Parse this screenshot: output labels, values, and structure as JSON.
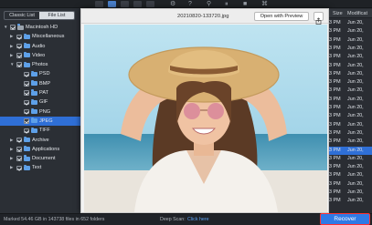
{
  "toolbar": {
    "icons": [
      "list-view-icon",
      "grid-view-icon",
      "column-view-icon",
      "filter-icon",
      "gear-icon",
      "sort-icon",
      "help-icon",
      "search-icon",
      "pause-icon",
      "stop-icon",
      "tag-icon"
    ]
  },
  "sidebar": {
    "tabs": [
      "Classic List",
      "File List"
    ],
    "active_tab": "File List",
    "items": [
      {
        "label": "Macintosh HD",
        "level": 0,
        "expanded": true,
        "checked": true,
        "icon": "drive-icon"
      },
      {
        "label": "Miscellaneous",
        "level": 1,
        "expanded": false,
        "checked": true,
        "icon": "folder-icon"
      },
      {
        "label": "Audio",
        "level": 1,
        "expanded": false,
        "checked": true,
        "icon": "folder-icon"
      },
      {
        "label": "Video",
        "level": 1,
        "expanded": false,
        "checked": true,
        "icon": "folder-icon"
      },
      {
        "label": "Photos",
        "level": 1,
        "expanded": true,
        "checked": true,
        "icon": "folder-icon"
      },
      {
        "label": "PSD",
        "level": 2,
        "checked": true,
        "icon": "folder-icon"
      },
      {
        "label": "BMP",
        "level": 2,
        "checked": true,
        "icon": "folder-icon"
      },
      {
        "label": "PAT",
        "level": 2,
        "checked": true,
        "icon": "folder-icon"
      },
      {
        "label": "GIF",
        "level": 2,
        "checked": true,
        "icon": "folder-icon"
      },
      {
        "label": "PNG",
        "level": 2,
        "checked": true,
        "icon": "folder-icon"
      },
      {
        "label": "JPEG",
        "level": 2,
        "checked": true,
        "icon": "folder-icon",
        "selected": true
      },
      {
        "label": "TIFF",
        "level": 2,
        "checked": true,
        "icon": "folder-icon"
      },
      {
        "label": "Archive",
        "level": 1,
        "expanded": false,
        "checked": true,
        "icon": "folder-icon"
      },
      {
        "label": "Applications",
        "level": 1,
        "expanded": false,
        "checked": true,
        "icon": "folder-icon"
      },
      {
        "label": "Document",
        "level": 1,
        "expanded": false,
        "checked": true,
        "icon": "folder-icon"
      },
      {
        "label": "Text",
        "level": 1,
        "expanded": false,
        "checked": true,
        "icon": "folder-icon"
      }
    ]
  },
  "preview": {
    "title": "20210820-133720.jpg",
    "open_button": "Open with Preview",
    "share_icon": "share-icon",
    "image_alt": "woman-in-straw-hat-photo"
  },
  "list": {
    "header_size": "Size",
    "header_modified": "Modificat",
    "rows": [
      {
        "time": "3 PM",
        "date": "Jun 20,"
      },
      {
        "time": "3 PM",
        "date": "Jun 20,"
      },
      {
        "time": "3 PM",
        "date": "Jun 20,"
      },
      {
        "time": "3 PM",
        "date": "Jun 20,"
      },
      {
        "time": "3 PM",
        "date": "Jun 20,"
      },
      {
        "time": "3 PM",
        "date": "Jun 20,"
      },
      {
        "time": "3 PM",
        "date": "Jun 20,"
      },
      {
        "time": "3 PM",
        "date": "Jun 20,"
      },
      {
        "time": "3 PM",
        "date": "Jun 20,"
      },
      {
        "time": "3 PM",
        "date": "Jun 20,"
      },
      {
        "time": "3 PM",
        "date": "Jun 20,"
      },
      {
        "time": "3 PM",
        "date": "Jun 20,"
      },
      {
        "time": "3 PM",
        "date": "Jun 20,"
      },
      {
        "time": "3 PM",
        "date": "Jun 20,"
      },
      {
        "time": "3 PM",
        "date": "Jun 20,"
      },
      {
        "time": "3 PM",
        "date": "Jun 20,",
        "selected": true
      },
      {
        "time": "3 PM",
        "date": "Jun 20,"
      },
      {
        "time": "3 PM",
        "date": "Jun 20,"
      },
      {
        "time": "3 PM",
        "date": "Jun 20,"
      },
      {
        "time": "3 PM",
        "date": "Jun 20,"
      },
      {
        "time": "3 PM",
        "date": "Jun 20,"
      },
      {
        "time": "3 PM",
        "date": "Jun 20,"
      }
    ]
  },
  "status": {
    "summary": "Marked 54.46 GB in 143738 files in 652 folders",
    "deep_scan_label": "Deep Scan:",
    "deep_scan_link": "Click here"
  },
  "recover_button": "Recover",
  "colors": {
    "accent": "#2f7ae6",
    "selection": "#2f6fd6",
    "highlight_border": "#ff3030",
    "folder": "#5ea0e8"
  }
}
